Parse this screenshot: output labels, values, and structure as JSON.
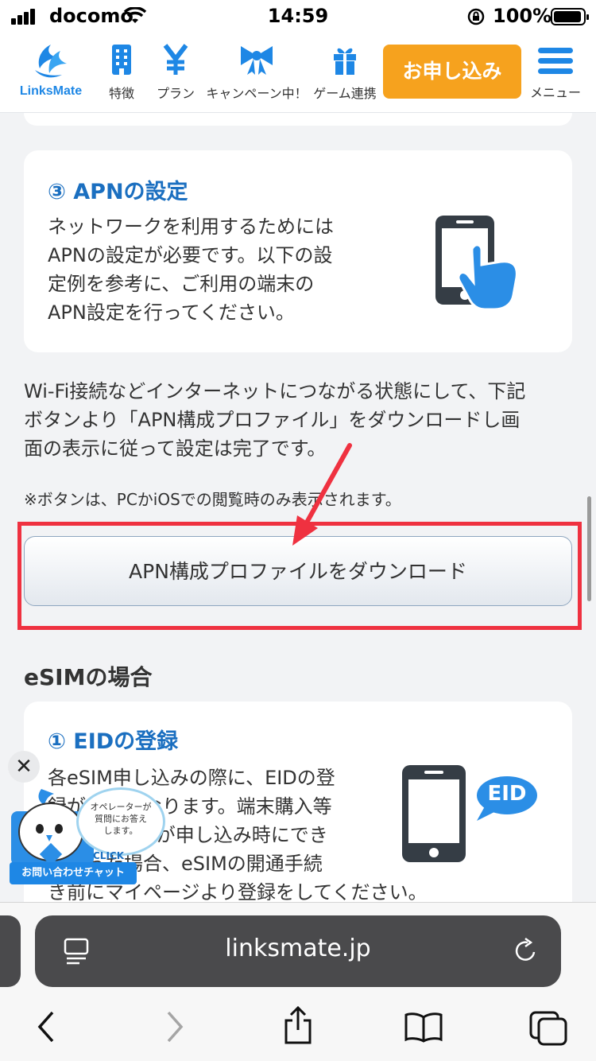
{
  "status_bar": {
    "carrier": "docomo",
    "time": "14:59",
    "battery": "100%"
  },
  "header": {
    "logo_text": "LinksMate",
    "nav": [
      {
        "label": "特徴",
        "icon": "building-icon"
      },
      {
        "label": "プラン",
        "icon": "yen-icon"
      },
      {
        "label": "キャンペーン中！",
        "icon": "ribbon-icon"
      },
      {
        "label": "ゲーム連携",
        "icon": "gift-icon"
      }
    ],
    "apply_label": "お申し込み",
    "menu_label": "メニュー"
  },
  "apn_card": {
    "title": "③ APNの設定",
    "lines": [
      "ネットワークを利用するためには",
      "APNの設定が必要です。以下の設",
      "定例を参考に、ご利用の端末の",
      "APN設定を行ってください。"
    ]
  },
  "instructions": {
    "lines": [
      "Wi-Fi接続などインターネットにつながる状態にして、下記",
      "ボタンより「APN構成プロファイル」をダウンロードし画",
      "面の表示に従って設定は完了です。"
    ],
    "note": "※ボタンは、PCかiOSでの閲覧時のみ表示されます。"
  },
  "download_button": "APN構成プロファイルをダウンロード",
  "esim": {
    "heading": "eSIMの場合",
    "card_title": "① EIDの登録",
    "eid_badge": "EID",
    "lines": [
      "各eSIM申し込みの際に、EIDの登",
      "録が必要になります。端末購入等",
      "でEIDの入力が申し込み時にでき",
      "なかった場合、eSIMの開通手続",
      "き前にマイページより登録をしてください。"
    ]
  },
  "chat": {
    "bubble": [
      "オペレーターが",
      "質問にお答え",
      "します。"
    ],
    "click": "CLICK",
    "label": "お問い合わせチャット"
  },
  "safari": {
    "url": "linksmate.jp"
  },
  "colors": {
    "brand_blue": "#1e87e5",
    "apply_orange": "#f6a21e",
    "highlight_red": "#ef3140"
  }
}
